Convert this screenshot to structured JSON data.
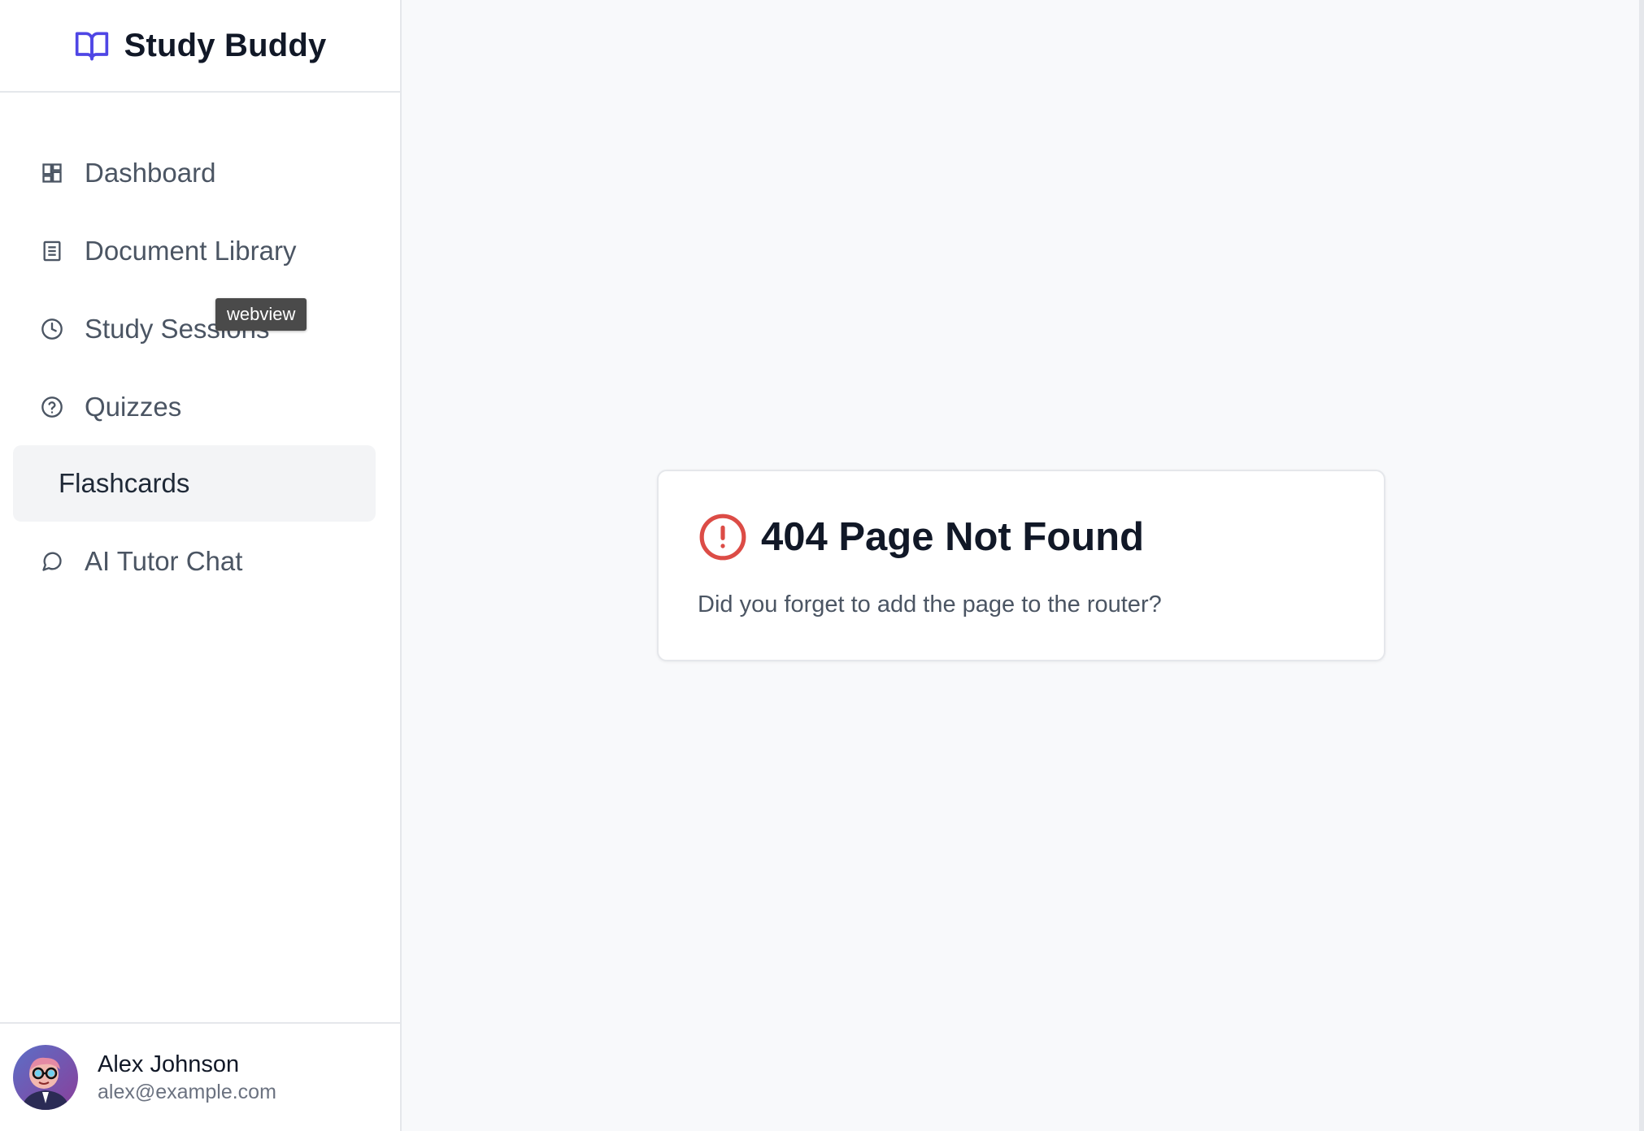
{
  "brand": {
    "title": "Study Buddy",
    "icon": "book-open-icon",
    "accent_color": "#4f46e5"
  },
  "sidebar": {
    "items": [
      {
        "label": "Dashboard",
        "icon": "dashboard-icon",
        "active": false
      },
      {
        "label": "Document Library",
        "icon": "document-icon",
        "active": false
      },
      {
        "label": "Study Sessions",
        "icon": "clock-icon",
        "active": false
      },
      {
        "label": "Quizzes",
        "icon": "question-circle-icon",
        "active": false
      },
      {
        "label": "Flashcards",
        "icon": "",
        "active": true
      },
      {
        "label": "AI Tutor Chat",
        "icon": "chat-bubble-icon",
        "active": false
      }
    ]
  },
  "tooltip": {
    "text": "webview"
  },
  "user": {
    "name": "Alex Johnson",
    "email": "alex@example.com"
  },
  "main": {
    "error": {
      "title": "404 Page Not Found",
      "message": "Did you forget to add the page to the router?",
      "icon": "alert-circle-icon",
      "icon_color": "#dc4c46"
    }
  }
}
